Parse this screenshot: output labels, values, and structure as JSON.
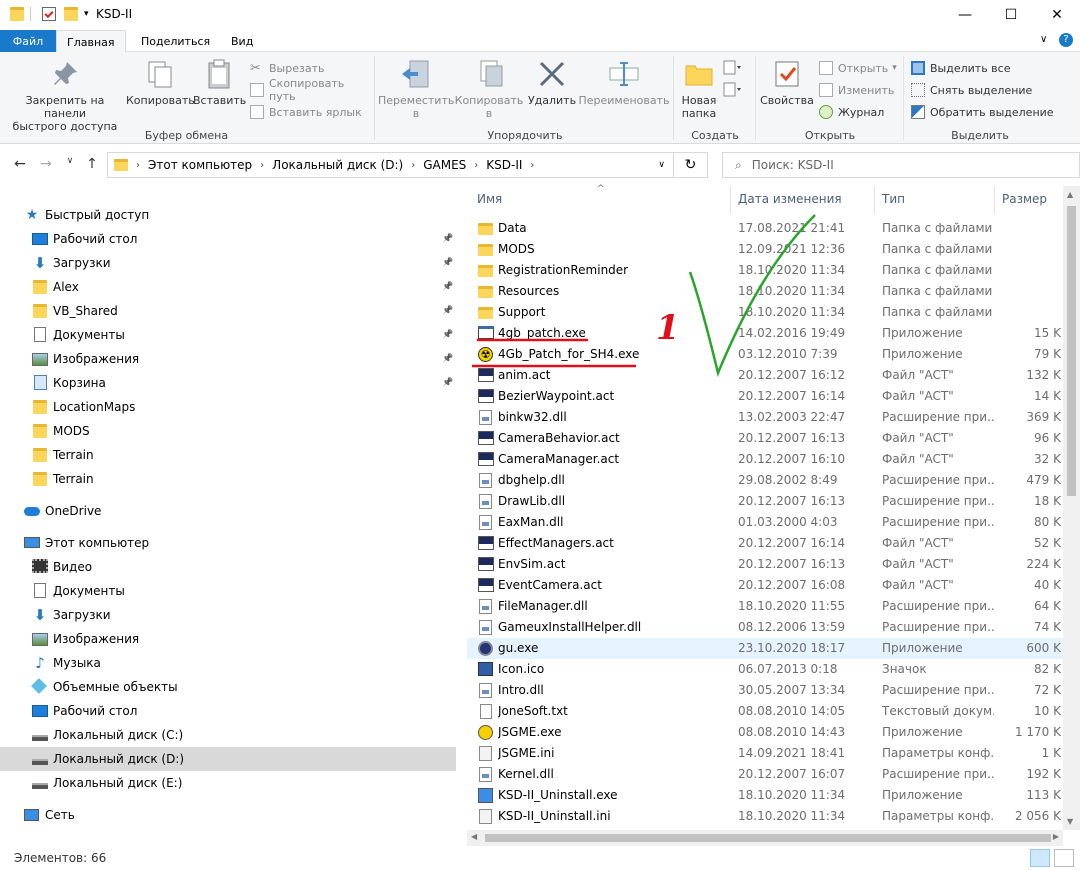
{
  "window": {
    "title": "KSD-II"
  },
  "menu": {
    "file": "Файл",
    "home": "Главная",
    "share": "Поделиться",
    "view": "Вид"
  },
  "ribbon": {
    "clipboard": {
      "pin": "Закрепить на панели\nбыстрого доступа",
      "copy": "Копировать",
      "paste": "Вставить",
      "cut": "Вырезать",
      "copy_path": "Скопировать путь",
      "paste_shortcut": "Вставить ярлык",
      "label": "Буфер обмена"
    },
    "organize": {
      "move": "Переместить\nв",
      "copy_to": "Копировать\nв",
      "delete": "Удалить",
      "rename": "Переименовать",
      "label": "Упорядочить"
    },
    "create": {
      "new_folder": "Новая\nпапка",
      "label": "Создать"
    },
    "open": {
      "properties": "Свойства",
      "open": "Открыть",
      "edit": "Изменить",
      "history": "Журнал",
      "label": "Открыть"
    },
    "select": {
      "select_all": "Выделить все",
      "select_none": "Снять выделение",
      "invert": "Обратить выделение",
      "label": "Выделить"
    }
  },
  "address": {
    "crumbs": [
      "Этот компьютер",
      "Локальный диск (D:)",
      "GAMES",
      "KSD-II"
    ],
    "search_placeholder": "Поиск: KSD-II"
  },
  "nav": {
    "quick_access": "Быстрый доступ",
    "quick_items": [
      "Рабочий стол",
      "Загрузки",
      "Alex",
      "VB_Shared",
      "Документы",
      "Изображения",
      "Корзина",
      "LocationMaps",
      "MODS",
      "Terrain",
      "Terrain"
    ],
    "onedrive": "OneDrive",
    "this_pc": "Этот компьютер",
    "pc_items": [
      "Видео",
      "Документы",
      "Загрузки",
      "Изображения",
      "Музыка",
      "Объемные объекты",
      "Рабочий стол",
      "Локальный диск (C:)",
      "Локальный диск (D:)",
      "Локальный диск (E:)"
    ],
    "network": "Сеть"
  },
  "columns": {
    "name": "Имя",
    "date": "Дата изменения",
    "type": "Тип",
    "size": "Размер"
  },
  "files": [
    {
      "name": "Data",
      "date": "17.08.2021 21:41",
      "type": "Папка с файлами",
      "size": "",
      "icon": "folder"
    },
    {
      "name": "MODS",
      "date": "12.09.2021 12:36",
      "type": "Папка с файлами",
      "size": "",
      "icon": "folder"
    },
    {
      "name": "RegistrationReminder",
      "date": "18.10.2020 11:34",
      "type": "Папка с файлами",
      "size": "",
      "icon": "folder"
    },
    {
      "name": "Resources",
      "date": "18.10.2020 11:34",
      "type": "Папка с файлами",
      "size": "",
      "icon": "folder"
    },
    {
      "name": "Support",
      "date": "18.10.2020 11:34",
      "type": "Папка с файлами",
      "size": "",
      "icon": "folder"
    },
    {
      "name": "4gb_patch.exe",
      "date": "14.02.2016 19:49",
      "type": "Приложение",
      "size": "15 K",
      "icon": "exe"
    },
    {
      "name": "4Gb_Patch_for_SH4.exe",
      "date": "03.12.2010 7:39",
      "type": "Приложение",
      "size": "79 K",
      "icon": "radiation"
    },
    {
      "name": "anim.act",
      "date": "20.12.2007 16:12",
      "type": "Файл \"ACT\"",
      "size": "132 K",
      "icon": "act"
    },
    {
      "name": "BezierWaypoint.act",
      "date": "20.12.2007 16:14",
      "type": "Файл \"ACT\"",
      "size": "14 K",
      "icon": "act"
    },
    {
      "name": "binkw32.dll",
      "date": "13.02.2003 22:47",
      "type": "Расширение при...",
      "size": "369 K",
      "icon": "dll"
    },
    {
      "name": "CameraBehavior.act",
      "date": "20.12.2007 16:13",
      "type": "Файл \"ACT\"",
      "size": "96 K",
      "icon": "act"
    },
    {
      "name": "CameraManager.act",
      "date": "20.12.2007 16:10",
      "type": "Файл \"ACT\"",
      "size": "32 K",
      "icon": "act"
    },
    {
      "name": "dbghelp.dll",
      "date": "29.08.2002 8:49",
      "type": "Расширение при...",
      "size": "479 K",
      "icon": "dll"
    },
    {
      "name": "DrawLib.dll",
      "date": "20.12.2007 16:13",
      "type": "Расширение при...",
      "size": "18 K",
      "icon": "dll"
    },
    {
      "name": "EaxMan.dll",
      "date": "01.03.2000 4:03",
      "type": "Расширение при...",
      "size": "80 K",
      "icon": "dll"
    },
    {
      "name": "EffectManagers.act",
      "date": "20.12.2007 16:14",
      "type": "Файл \"ACT\"",
      "size": "52 K",
      "icon": "act"
    },
    {
      "name": "EnvSim.act",
      "date": "20.12.2007 16:13",
      "type": "Файл \"ACT\"",
      "size": "224 K",
      "icon": "act"
    },
    {
      "name": "EventCamera.act",
      "date": "20.12.2007 16:08",
      "type": "Файл \"ACT\"",
      "size": "40 K",
      "icon": "act"
    },
    {
      "name": "FileManager.dll",
      "date": "18.10.2020 11:55",
      "type": "Расширение при...",
      "size": "64 K",
      "icon": "dll"
    },
    {
      "name": "GameuxInstallHelper.dll",
      "date": "08.12.2006 13:59",
      "type": "Расширение при...",
      "size": "74 K",
      "icon": "dll"
    },
    {
      "name": "gu.exe",
      "date": "23.10.2020 18:17",
      "type": "Приложение",
      "size": "600 K",
      "icon": "gu"
    },
    {
      "name": "Icon.ico",
      "date": "06.07.2013 0:18",
      "type": "Значок",
      "size": "82 K",
      "icon": "ico"
    },
    {
      "name": "Intro.dll",
      "date": "30.05.2007 13:34",
      "type": "Расширение при...",
      "size": "72 K",
      "icon": "dll"
    },
    {
      "name": "JoneSoft.txt",
      "date": "08.08.2010 14:05",
      "type": "Текстовый докум...",
      "size": "10 K",
      "icon": "txt"
    },
    {
      "name": "JSGME.exe",
      "date": "08.08.2010 14:43",
      "type": "Приложение",
      "size": "1 170 K",
      "icon": "jsgme"
    },
    {
      "name": "JSGME.ini",
      "date": "14.09.2021 18:41",
      "type": "Параметры конф...",
      "size": "1 K",
      "icon": "ini"
    },
    {
      "name": "Kernel.dll",
      "date": "20.12.2007 16:07",
      "type": "Расширение при...",
      "size": "192 K",
      "icon": "dll"
    },
    {
      "name": "KSD-II_Uninstall.exe",
      "date": "18.10.2020 11:34",
      "type": "Приложение",
      "size": "113 K",
      "icon": "uninst"
    },
    {
      "name": "KSD-II_Uninstall.ini",
      "date": "18.10.2020 11:34",
      "type": "Параметры конф...",
      "size": "2 056 K",
      "icon": "ini"
    }
  ],
  "annotation": {
    "number": "1",
    "mark_color": "#2aa52a",
    "underline_color": "#e0101a"
  },
  "status": {
    "count": "Элементов: 66"
  }
}
